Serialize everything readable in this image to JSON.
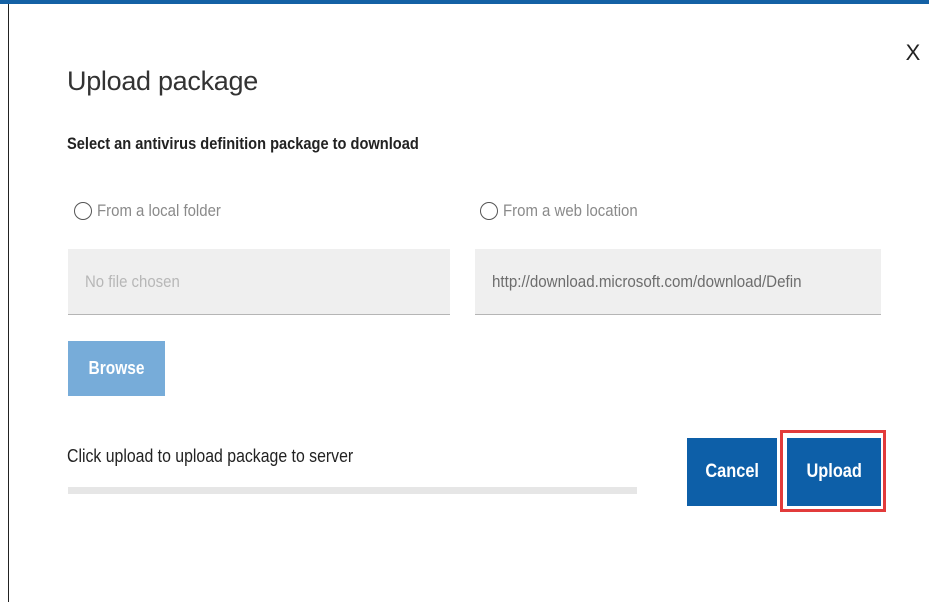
{
  "dialog": {
    "title": "Upload package",
    "close_label": "X",
    "subtitle": "Select an antivirus definition package to download"
  },
  "options": {
    "local_folder_label": "From a local folder",
    "web_location_label": "From a web location",
    "selected": null
  },
  "file_input": {
    "placeholder": "No file chosen"
  },
  "url_input": {
    "value": "http://download.microsoft.com/download/Defin"
  },
  "buttons": {
    "browse_label": "Browse",
    "cancel_label": "Cancel",
    "upload_label": "Upload"
  },
  "status": {
    "text": "Click upload to upload package to server",
    "progress_fraction": 0
  },
  "colors": {
    "accent": "#0d5fa8",
    "browse_disabled": "#77acd9",
    "highlight": "#e23b3b"
  }
}
